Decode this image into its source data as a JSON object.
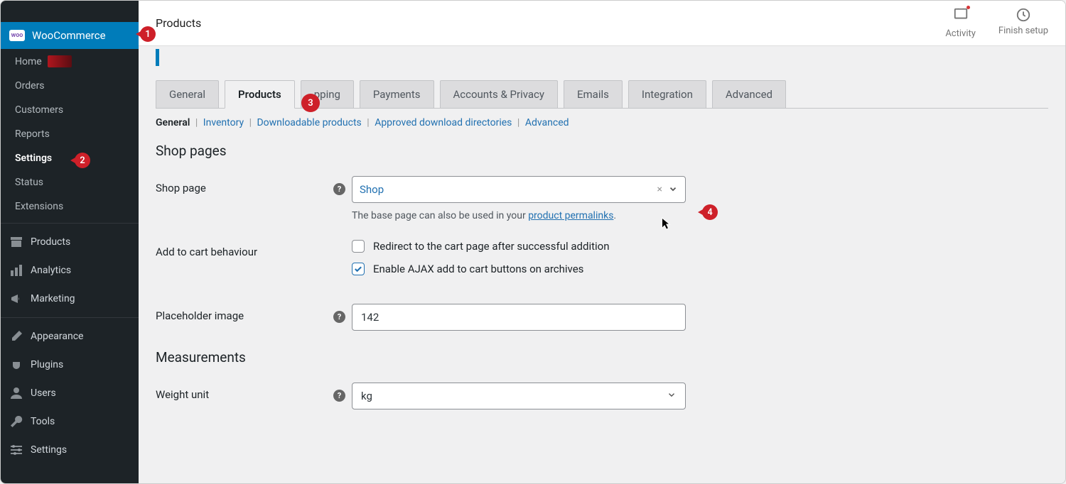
{
  "sidebar": {
    "brand": "WooCommerce",
    "brand_logo": "woo",
    "sub": {
      "home": "Home",
      "orders": "Orders",
      "customers": "Customers",
      "reports": "Reports",
      "settings": "Settings",
      "status": "Status",
      "extensions": "Extensions"
    },
    "menu": {
      "products": "Products",
      "analytics": "Analytics",
      "marketing": "Marketing",
      "appearance": "Appearance",
      "plugins": "Plugins",
      "users": "Users",
      "tools": "Tools",
      "settings2": "Settings"
    }
  },
  "topbar": {
    "title": "Products",
    "activity": "Activity",
    "finish": "Finish setup"
  },
  "tabs": {
    "general": "General",
    "products": "Products",
    "shipping": "pping",
    "payments": "Payments",
    "accounts": "Accounts & Privacy",
    "emails": "Emails",
    "integration": "Integration",
    "advanced": "Advanced"
  },
  "subtabs": {
    "general": "General",
    "inventory": "Inventory",
    "downloadable": "Downloadable products",
    "approved": "Approved download directories",
    "advanced": "Advanced"
  },
  "sections": {
    "shop_pages": "Shop pages",
    "measurements": "Measurements"
  },
  "fields": {
    "shop_page_label": "Shop page",
    "shop_page_value": "Shop",
    "shop_page_hint_prefix": "The base page can also be used in your ",
    "shop_page_hint_link": "product permalinks",
    "add_to_cart_label": "Add to cart behaviour",
    "redirect_label": "Redirect to the cart page after successful addition",
    "ajax_label": "Enable AJAX add to cart buttons on archives",
    "placeholder_label": "Placeholder image",
    "placeholder_value": "142",
    "weight_label": "Weight unit",
    "weight_value": "kg"
  },
  "callouts": {
    "c1": "1",
    "c2": "2",
    "c3": "3",
    "c4": "4"
  }
}
